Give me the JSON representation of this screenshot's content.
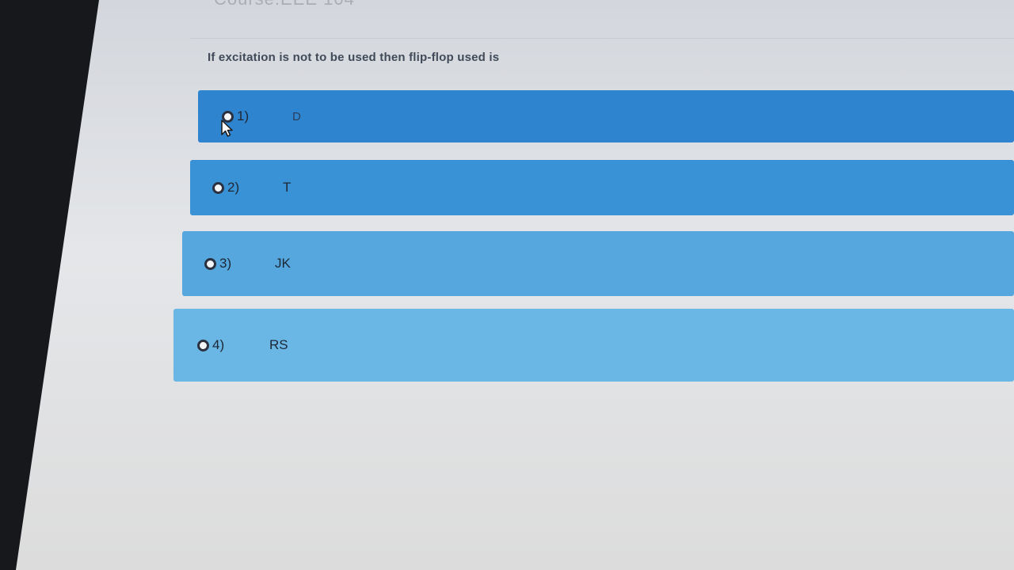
{
  "page": {
    "header_partial": "Course:EEE 104",
    "question": "If excitation is not to be used then flip-flop used is"
  },
  "options": [
    {
      "number": "1)",
      "label": "D",
      "selected": false
    },
    {
      "number": "2)",
      "label": "T",
      "selected": false
    },
    {
      "number": "3)",
      "label": "JK",
      "selected": false
    },
    {
      "number": "4)",
      "label": "RS",
      "selected": false
    }
  ],
  "colors": {
    "option_1": "#2f84cf",
    "option_2": "#3a92d6",
    "option_3": "#55a7de",
    "option_4": "#6ab7e6",
    "page_background": "#e4e6e9"
  },
  "icons": {
    "radio": "radio-unselected-icon",
    "cursor": "mouse-pointer-icon"
  }
}
